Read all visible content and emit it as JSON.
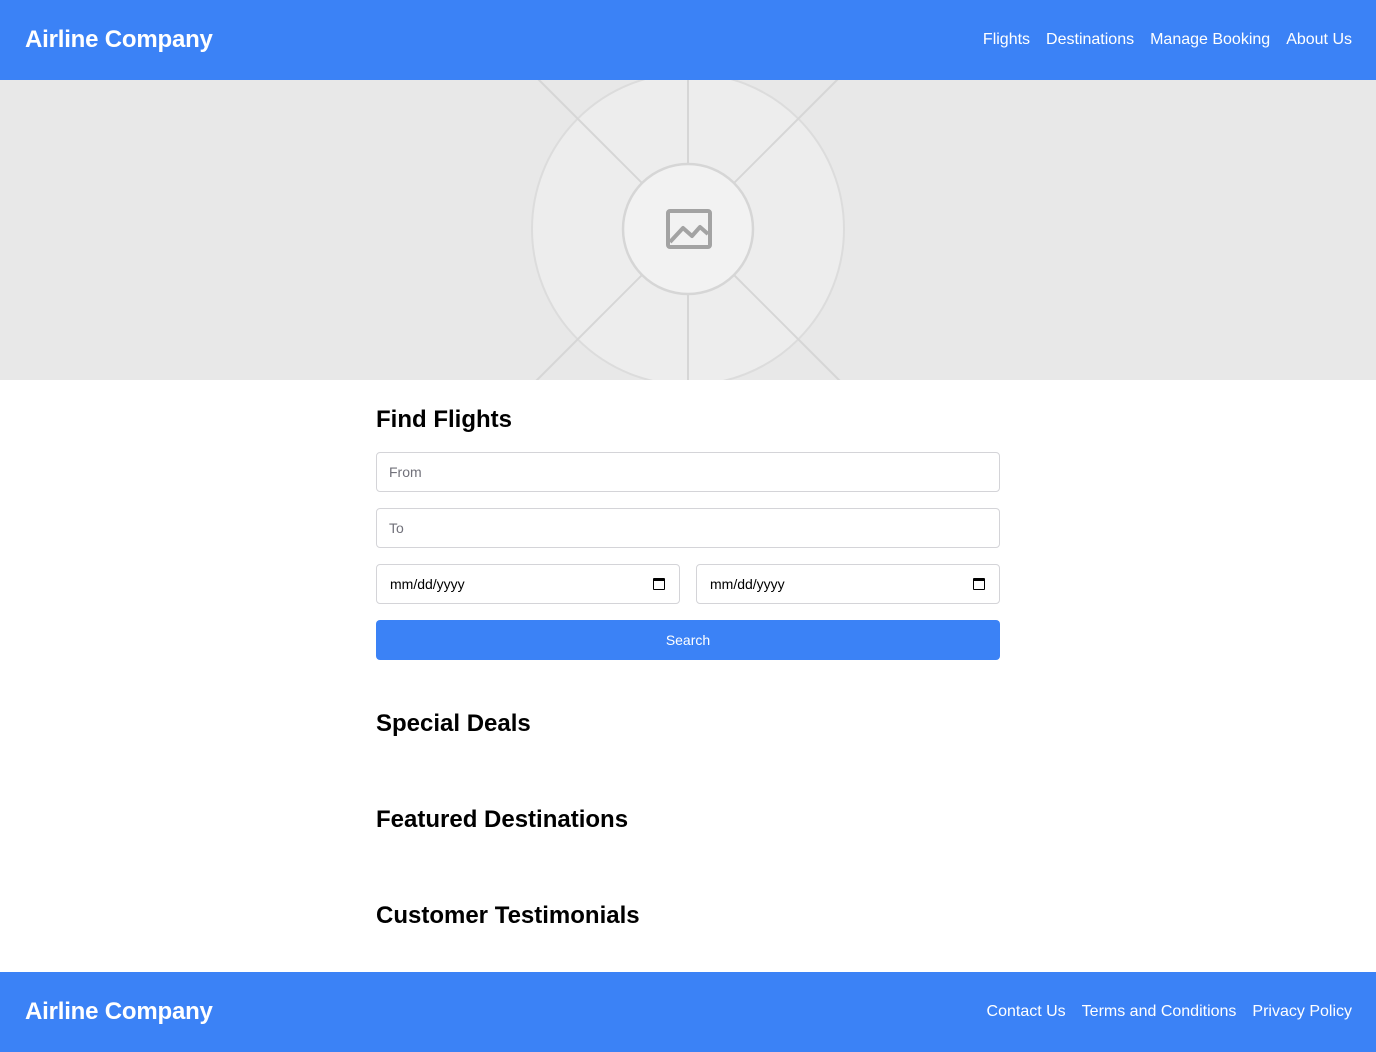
{
  "colors": {
    "accent": "#3b82f6",
    "hero_bg": "#e8e8e8"
  },
  "header": {
    "brand": "Airline Company",
    "nav": [
      {
        "label": "Flights"
      },
      {
        "label": "Destinations"
      },
      {
        "label": "Manage Booking"
      },
      {
        "label": "About Us"
      }
    ]
  },
  "hero": {
    "icon": "image-placeholder-icon"
  },
  "search_form": {
    "title": "Find Flights",
    "from_placeholder": "From",
    "to_placeholder": "To",
    "depart_date_placeholder": "mm/dd/yyyy",
    "return_date_placeholder": "mm/dd/yyyy",
    "date_icon": "calendar-icon",
    "search_label": "Search"
  },
  "sections": {
    "deals_title": "Special Deals",
    "featured_title": "Featured Destinations",
    "testimonials_title": "Customer Testimonials"
  },
  "footer": {
    "brand": "Airline Company",
    "links": [
      {
        "label": "Contact Us"
      },
      {
        "label": "Terms and Conditions"
      },
      {
        "label": "Privacy Policy"
      }
    ]
  }
}
